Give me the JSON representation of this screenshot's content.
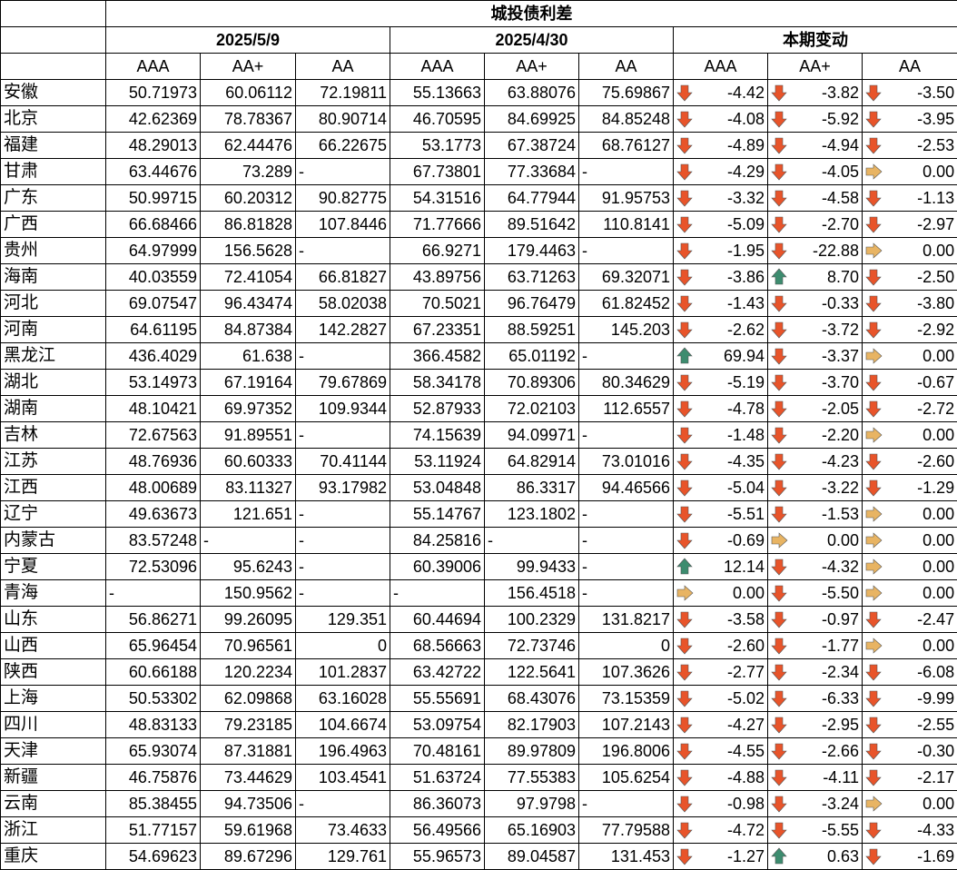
{
  "title": "城投债利差",
  "date_groups": [
    "2025/5/9",
    "2025/4/30",
    "本期变动"
  ],
  "grades": [
    "AAA",
    "AA+",
    "AA"
  ],
  "colors": {
    "down": "#e8542a",
    "up": "#3d8c6f",
    "flat": "#e8b463"
  },
  "rows": [
    {
      "province": "安徽",
      "d1": [
        "50.71973",
        "60.06112",
        "72.19811"
      ],
      "d2": [
        "55.13663",
        "63.88076",
        "75.69867"
      ],
      "chg": [
        {
          "dir": "down",
          "v": "-4.42"
        },
        {
          "dir": "down",
          "v": "-3.82"
        },
        {
          "dir": "down",
          "v": "-3.50"
        }
      ]
    },
    {
      "province": "北京",
      "d1": [
        "42.62369",
        "78.78367",
        "80.90714"
      ],
      "d2": [
        "46.70595",
        "84.69925",
        "84.85248"
      ],
      "chg": [
        {
          "dir": "down",
          "v": "-4.08"
        },
        {
          "dir": "down",
          "v": "-5.92"
        },
        {
          "dir": "down",
          "v": "-3.95"
        }
      ]
    },
    {
      "province": "福建",
      "d1": [
        "48.29013",
        "62.44476",
        "66.22675"
      ],
      "d2": [
        "53.1773",
        "67.38724",
        "68.76127"
      ],
      "chg": [
        {
          "dir": "down",
          "v": "-4.89"
        },
        {
          "dir": "down",
          "v": "-4.94"
        },
        {
          "dir": "down",
          "v": "-2.53"
        }
      ]
    },
    {
      "province": "甘肃",
      "d1": [
        "63.44676",
        "73.289",
        "-"
      ],
      "d2": [
        "67.73801",
        "77.33684",
        "-"
      ],
      "chg": [
        {
          "dir": "down",
          "v": "-4.29"
        },
        {
          "dir": "down",
          "v": "-4.05"
        },
        {
          "dir": "flat",
          "v": "0.00"
        }
      ]
    },
    {
      "province": "广东",
      "d1": [
        "50.99715",
        "60.20312",
        "90.82775"
      ],
      "d2": [
        "54.31516",
        "64.77944",
        "91.95753"
      ],
      "chg": [
        {
          "dir": "down",
          "v": "-3.32"
        },
        {
          "dir": "down",
          "v": "-4.58"
        },
        {
          "dir": "down",
          "v": "-1.13"
        }
      ]
    },
    {
      "province": "广西",
      "d1": [
        "66.68466",
        "86.81828",
        "107.8446"
      ],
      "d2": [
        "71.77666",
        "89.51642",
        "110.8141"
      ],
      "chg": [
        {
          "dir": "down",
          "v": "-5.09"
        },
        {
          "dir": "down",
          "v": "-2.70"
        },
        {
          "dir": "down",
          "v": "-2.97"
        }
      ]
    },
    {
      "province": "贵州",
      "d1": [
        "64.97999",
        "156.5628",
        "-"
      ],
      "d2": [
        "66.9271",
        "179.4463",
        "-"
      ],
      "chg": [
        {
          "dir": "down",
          "v": "-1.95"
        },
        {
          "dir": "down",
          "v": "-22.88"
        },
        {
          "dir": "flat",
          "v": "0.00"
        }
      ]
    },
    {
      "province": "海南",
      "d1": [
        "40.03559",
        "72.41054",
        "66.81827"
      ],
      "d2": [
        "43.89756",
        "63.71263",
        "69.32071"
      ],
      "chg": [
        {
          "dir": "down",
          "v": "-3.86"
        },
        {
          "dir": "up",
          "v": "8.70"
        },
        {
          "dir": "down",
          "v": "-2.50"
        }
      ]
    },
    {
      "province": "河北",
      "d1": [
        "69.07547",
        "96.43474",
        "58.02038"
      ],
      "d2": [
        "70.5021",
        "96.76479",
        "61.82452"
      ],
      "chg": [
        {
          "dir": "down",
          "v": "-1.43"
        },
        {
          "dir": "down",
          "v": "-0.33"
        },
        {
          "dir": "down",
          "v": "-3.80"
        }
      ]
    },
    {
      "province": "河南",
      "d1": [
        "64.61195",
        "84.87384",
        "142.2827"
      ],
      "d2": [
        "67.23351",
        "88.59251",
        "145.203"
      ],
      "chg": [
        {
          "dir": "down",
          "v": "-2.62"
        },
        {
          "dir": "down",
          "v": "-3.72"
        },
        {
          "dir": "down",
          "v": "-2.92"
        }
      ]
    },
    {
      "province": "黑龙江",
      "d1": [
        "436.4029",
        "61.638",
        "-"
      ],
      "d2": [
        "366.4582",
        "65.01192",
        "-"
      ],
      "chg": [
        {
          "dir": "up",
          "v": "69.94"
        },
        {
          "dir": "down",
          "v": "-3.37"
        },
        {
          "dir": "flat",
          "v": "0.00"
        }
      ]
    },
    {
      "province": "湖北",
      "d1": [
        "53.14973",
        "67.19164",
        "79.67869"
      ],
      "d2": [
        "58.34178",
        "70.89306",
        "80.34629"
      ],
      "chg": [
        {
          "dir": "down",
          "v": "-5.19"
        },
        {
          "dir": "down",
          "v": "-3.70"
        },
        {
          "dir": "down",
          "v": "-0.67"
        }
      ]
    },
    {
      "province": "湖南",
      "d1": [
        "48.10421",
        "69.97352",
        "109.9344"
      ],
      "d2": [
        "52.87933",
        "72.02103",
        "112.6557"
      ],
      "chg": [
        {
          "dir": "down",
          "v": "-4.78"
        },
        {
          "dir": "down",
          "v": "-2.05"
        },
        {
          "dir": "down",
          "v": "-2.72"
        }
      ]
    },
    {
      "province": "吉林",
      "d1": [
        "72.67563",
        "91.89551",
        "-"
      ],
      "d2": [
        "74.15639",
        "94.09971",
        "-"
      ],
      "chg": [
        {
          "dir": "down",
          "v": "-1.48"
        },
        {
          "dir": "down",
          "v": "-2.20"
        },
        {
          "dir": "flat",
          "v": "0.00"
        }
      ]
    },
    {
      "province": "江苏",
      "d1": [
        "48.76936",
        "60.60333",
        "70.41144"
      ],
      "d2": [
        "53.11924",
        "64.82914",
        "73.01016"
      ],
      "chg": [
        {
          "dir": "down",
          "v": "-4.35"
        },
        {
          "dir": "down",
          "v": "-4.23"
        },
        {
          "dir": "down",
          "v": "-2.60"
        }
      ]
    },
    {
      "province": "江西",
      "d1": [
        "48.00689",
        "83.11327",
        "93.17982"
      ],
      "d2": [
        "53.04848",
        "86.3317",
        "94.46566"
      ],
      "chg": [
        {
          "dir": "down",
          "v": "-5.04"
        },
        {
          "dir": "down",
          "v": "-3.22"
        },
        {
          "dir": "down",
          "v": "-1.29"
        }
      ]
    },
    {
      "province": "辽宁",
      "d1": [
        "49.63673",
        "121.651",
        "-"
      ],
      "d2": [
        "55.14767",
        "123.1802",
        "-"
      ],
      "chg": [
        {
          "dir": "down",
          "v": "-5.51"
        },
        {
          "dir": "down",
          "v": "-1.53"
        },
        {
          "dir": "flat",
          "v": "0.00"
        }
      ]
    },
    {
      "province": "内蒙古",
      "d1": [
        "83.57248",
        "-",
        "-"
      ],
      "d2": [
        "84.25816",
        "-",
        "-"
      ],
      "chg": [
        {
          "dir": "down",
          "v": "-0.69"
        },
        {
          "dir": "flat",
          "v": "0.00"
        },
        {
          "dir": "flat",
          "v": "0.00"
        }
      ]
    },
    {
      "province": "宁夏",
      "d1": [
        "72.53096",
        "95.6243",
        "-"
      ],
      "d2": [
        "60.39006",
        "99.9433",
        "-"
      ],
      "chg": [
        {
          "dir": "up",
          "v": "12.14"
        },
        {
          "dir": "down",
          "v": "-4.32"
        },
        {
          "dir": "flat",
          "v": "0.00"
        }
      ]
    },
    {
      "province": "青海",
      "d1": [
        "-",
        "150.9562",
        "-"
      ],
      "d2": [
        "-",
        "156.4518",
        "-"
      ],
      "chg": [
        {
          "dir": "flat",
          "v": "0.00"
        },
        {
          "dir": "down",
          "v": "-5.50"
        },
        {
          "dir": "flat",
          "v": "0.00"
        }
      ]
    },
    {
      "province": "山东",
      "d1": [
        "56.86271",
        "99.26095",
        "129.351"
      ],
      "d2": [
        "60.44694",
        "100.2329",
        "131.8217"
      ],
      "chg": [
        {
          "dir": "down",
          "v": "-3.58"
        },
        {
          "dir": "down",
          "v": "-0.97"
        },
        {
          "dir": "down",
          "v": "-2.47"
        }
      ]
    },
    {
      "province": "山西",
      "d1": [
        "65.96454",
        "70.96561",
        "0"
      ],
      "d2": [
        "68.56663",
        "72.73746",
        "0"
      ],
      "chg": [
        {
          "dir": "down",
          "v": "-2.60"
        },
        {
          "dir": "down",
          "v": "-1.77"
        },
        {
          "dir": "flat",
          "v": "0.00"
        }
      ]
    },
    {
      "province": "陕西",
      "d1": [
        "60.66188",
        "120.2234",
        "101.2837"
      ],
      "d2": [
        "63.42722",
        "122.5641",
        "107.3626"
      ],
      "chg": [
        {
          "dir": "down",
          "v": "-2.77"
        },
        {
          "dir": "down",
          "v": "-2.34"
        },
        {
          "dir": "down",
          "v": "-6.08"
        }
      ]
    },
    {
      "province": "上海",
      "d1": [
        "50.53302",
        "62.09868",
        "63.16028"
      ],
      "d2": [
        "55.55691",
        "68.43076",
        "73.15359"
      ],
      "chg": [
        {
          "dir": "down",
          "v": "-5.02"
        },
        {
          "dir": "down",
          "v": "-6.33"
        },
        {
          "dir": "down",
          "v": "-9.99"
        }
      ]
    },
    {
      "province": "四川",
      "d1": [
        "48.83133",
        "79.23185",
        "104.6674"
      ],
      "d2": [
        "53.09754",
        "82.17903",
        "107.2143"
      ],
      "chg": [
        {
          "dir": "down",
          "v": "-4.27"
        },
        {
          "dir": "down",
          "v": "-2.95"
        },
        {
          "dir": "down",
          "v": "-2.55"
        }
      ]
    },
    {
      "province": "天津",
      "d1": [
        "65.93074",
        "87.31881",
        "196.4963"
      ],
      "d2": [
        "70.48161",
        "89.97809",
        "196.8006"
      ],
      "chg": [
        {
          "dir": "down",
          "v": "-4.55"
        },
        {
          "dir": "down",
          "v": "-2.66"
        },
        {
          "dir": "down",
          "v": "-0.30"
        }
      ]
    },
    {
      "province": "新疆",
      "d1": [
        "46.75876",
        "73.44629",
        "103.4541"
      ],
      "d2": [
        "51.63724",
        "77.55383",
        "105.6254"
      ],
      "chg": [
        {
          "dir": "down",
          "v": "-4.88"
        },
        {
          "dir": "down",
          "v": "-4.11"
        },
        {
          "dir": "down",
          "v": "-2.17"
        }
      ]
    },
    {
      "province": "云南",
      "d1": [
        "85.38455",
        "94.73506",
        "-"
      ],
      "d2": [
        "86.36073",
        "97.9798",
        "-"
      ],
      "chg": [
        {
          "dir": "down",
          "v": "-0.98"
        },
        {
          "dir": "down",
          "v": "-3.24"
        },
        {
          "dir": "flat",
          "v": "0.00"
        }
      ]
    },
    {
      "province": "浙江",
      "d1": [
        "51.77157",
        "59.61968",
        "73.4633"
      ],
      "d2": [
        "56.49566",
        "65.16903",
        "77.79588"
      ],
      "chg": [
        {
          "dir": "down",
          "v": "-4.72"
        },
        {
          "dir": "down",
          "v": "-5.55"
        },
        {
          "dir": "down",
          "v": "-4.33"
        }
      ]
    },
    {
      "province": "重庆",
      "d1": [
        "54.69623",
        "89.67296",
        "129.761"
      ],
      "d2": [
        "55.96573",
        "89.04587",
        "131.453"
      ],
      "chg": [
        {
          "dir": "down",
          "v": "-1.27"
        },
        {
          "dir": "up",
          "v": "0.63"
        },
        {
          "dir": "down",
          "v": "-1.69"
        }
      ]
    }
  ]
}
